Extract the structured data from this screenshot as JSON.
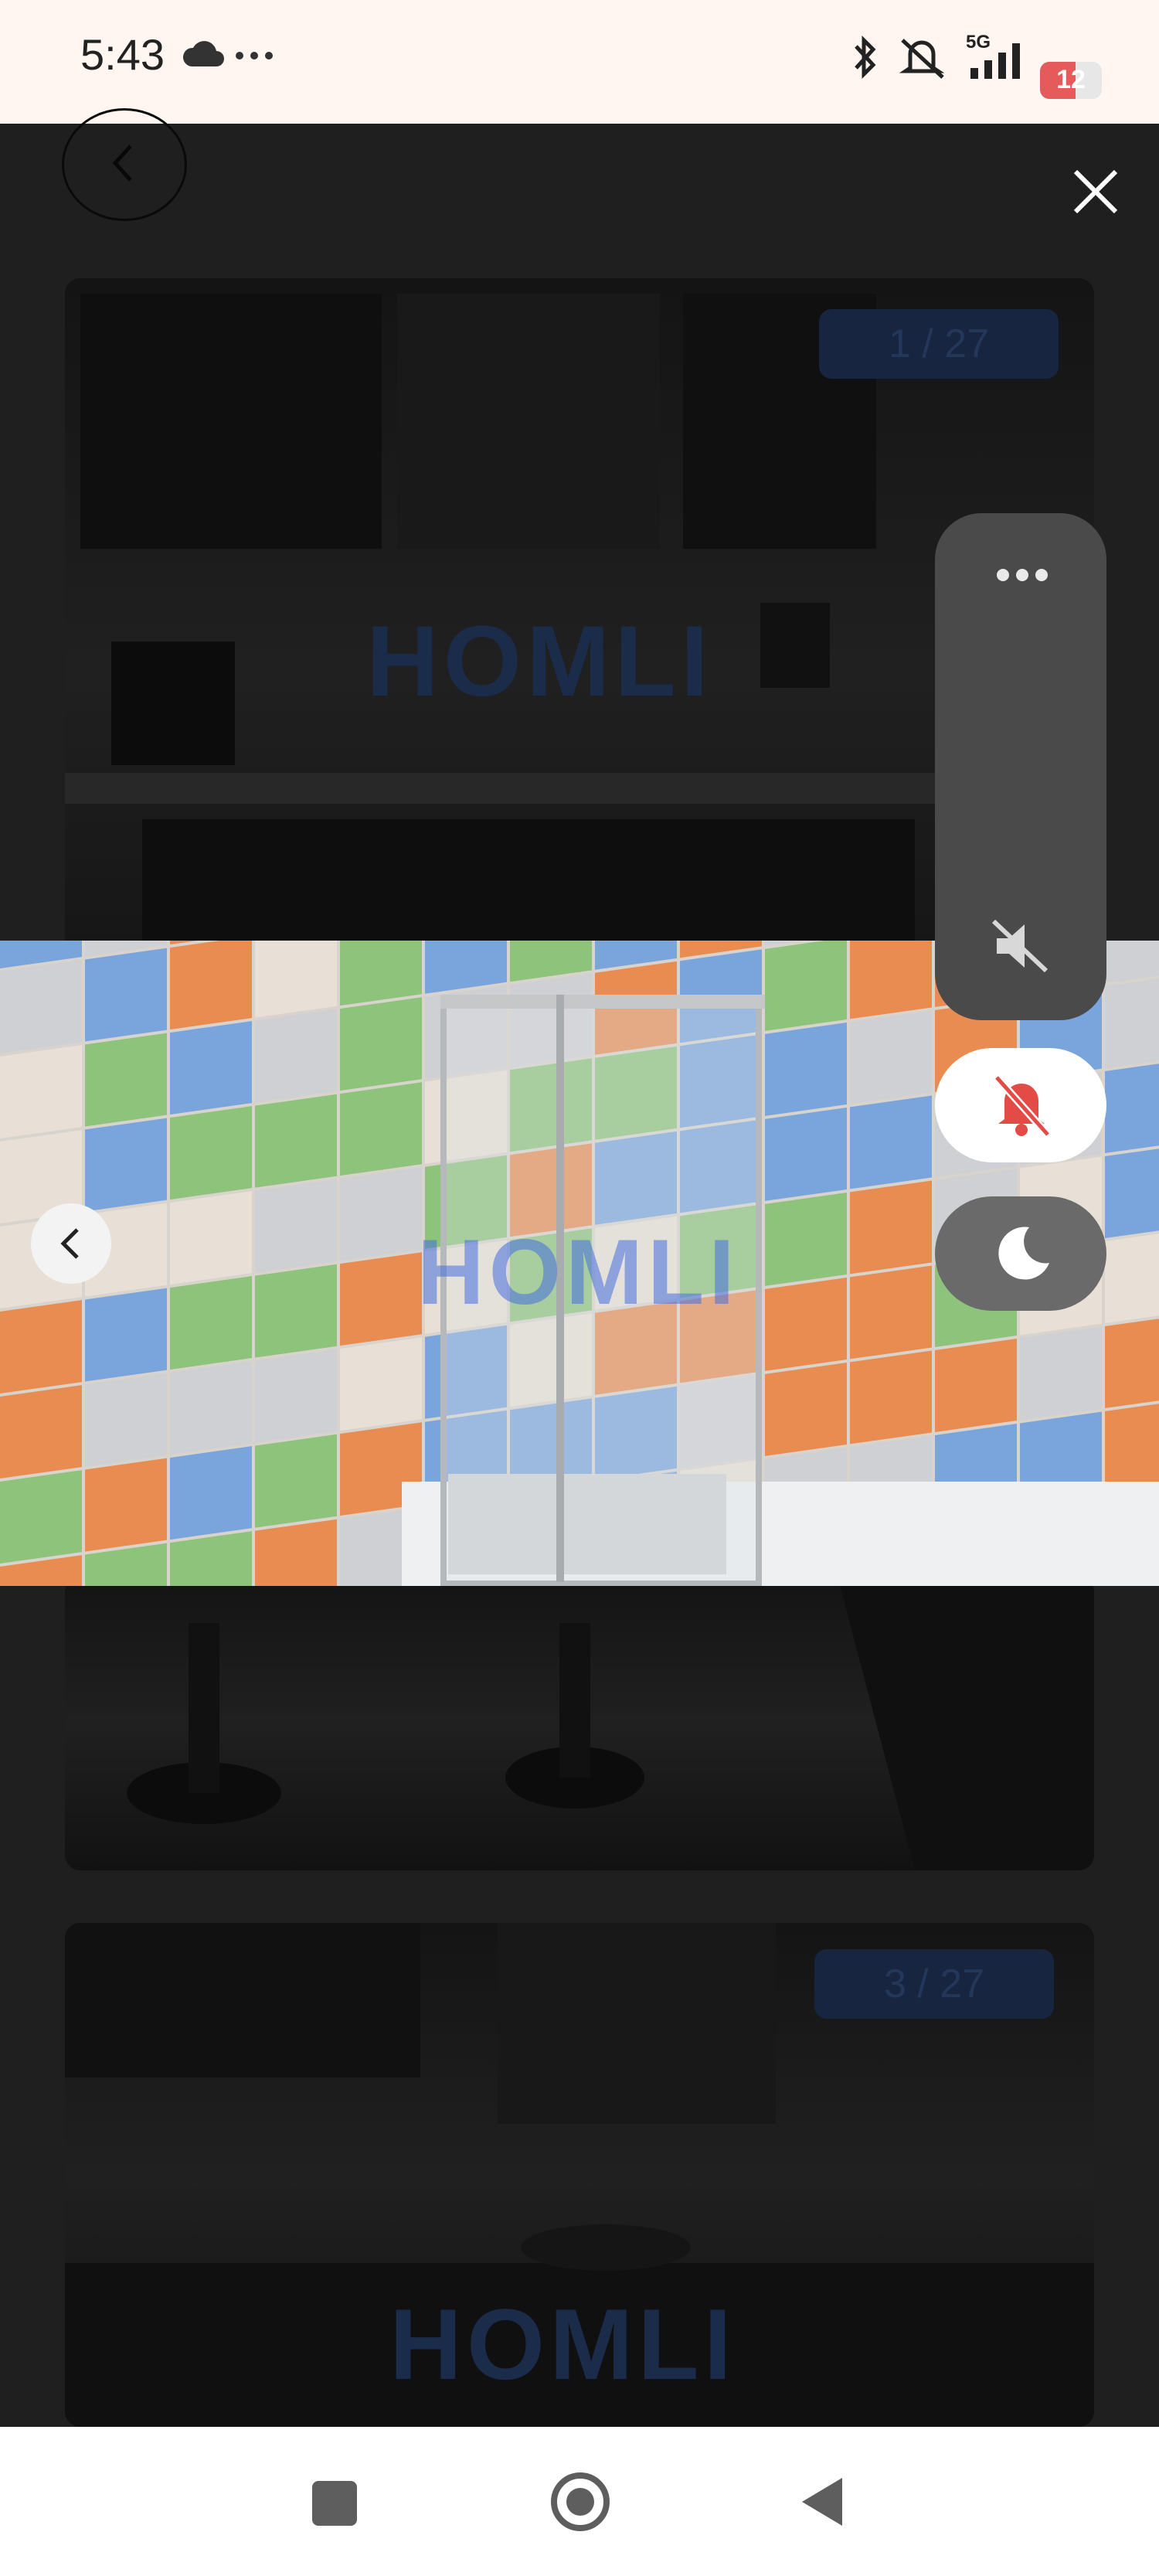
{
  "status_bar": {
    "time": "5:43",
    "icons": [
      "cloud-icon",
      "more-dots-icon",
      "bluetooth-icon",
      "silent-mode-icon",
      "signal-5g-icon",
      "battery-icon"
    ],
    "network_label": "5G",
    "battery": "12"
  },
  "gallery": {
    "counters": [
      "1 / 27",
      "3 / 27"
    ],
    "watermark_text": "HOMLI"
  },
  "floating_controls": {
    "items": [
      "more-options-icon",
      "mute-icon",
      "bell-off-icon",
      "moon-icon"
    ]
  },
  "colors": {
    "tile_orange": "#e98c52",
    "tile_blue": "#7aa4dc",
    "tile_green": "#8dc37a",
    "tile_grey": "#cfd0d4",
    "tile_cream": "#e8e0d6",
    "bell_red": "#e34b47"
  },
  "nav_bar": {
    "buttons": [
      "recents-button",
      "home-button",
      "back-button"
    ]
  }
}
